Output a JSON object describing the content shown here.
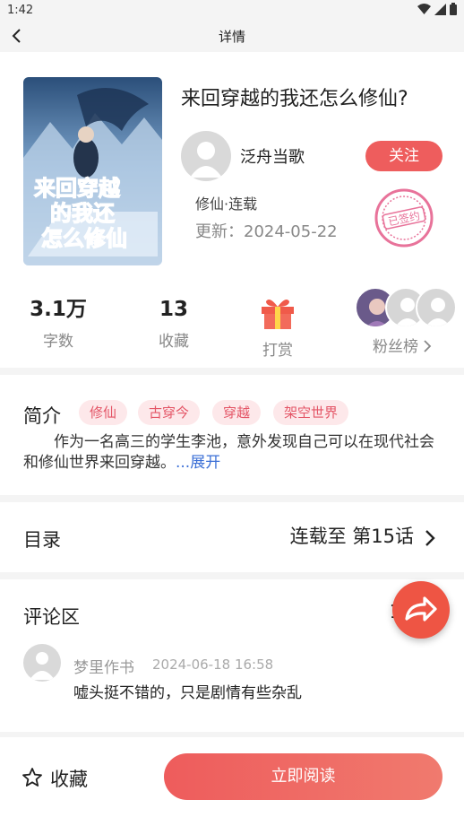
{
  "status_bar": {
    "time": "1:42"
  },
  "nav": {
    "title": "详情"
  },
  "book": {
    "title": "来回穿越的我还怎么修仙?",
    "cover_title_lines": [
      "来回穿越",
      "的我还",
      "怎么修仙"
    ],
    "author": "泛舟当歌",
    "follow_label": "关注",
    "genre": "修仙·连载",
    "updated": "更新：2024-05-22",
    "seal_text": "已签约"
  },
  "stats": {
    "word_count": "3.1万",
    "word_count_label": "字数",
    "favorites": "13",
    "favorites_label": "收藏",
    "tip_label": "打赏",
    "fans_label": "粉丝榜"
  },
  "intro": {
    "label": "简介",
    "tags": [
      "修仙",
      "古穿今",
      "穿越",
      "架空世界"
    ],
    "text": "作为一名高三的学生李池，意外发现自己可以在现代社会和修仙世界来回穿越。",
    "expand_label": "...展开"
  },
  "toc": {
    "label": "目录",
    "status": "连载至 第15话"
  },
  "comments": {
    "label": "评论区",
    "count": "1",
    "items": [
      {
        "user": "梦里作书",
        "time": "2024-06-18 16:58",
        "text": "嘘头挺不错的，只是剧情有些杂乱"
      }
    ]
  },
  "bottom": {
    "favorite_label": "收藏",
    "read_label": "立即阅读"
  },
  "colors": {
    "accent": "#ee5d5d",
    "tag_bg": "#fde8ea",
    "link": "#3b6fd6"
  }
}
